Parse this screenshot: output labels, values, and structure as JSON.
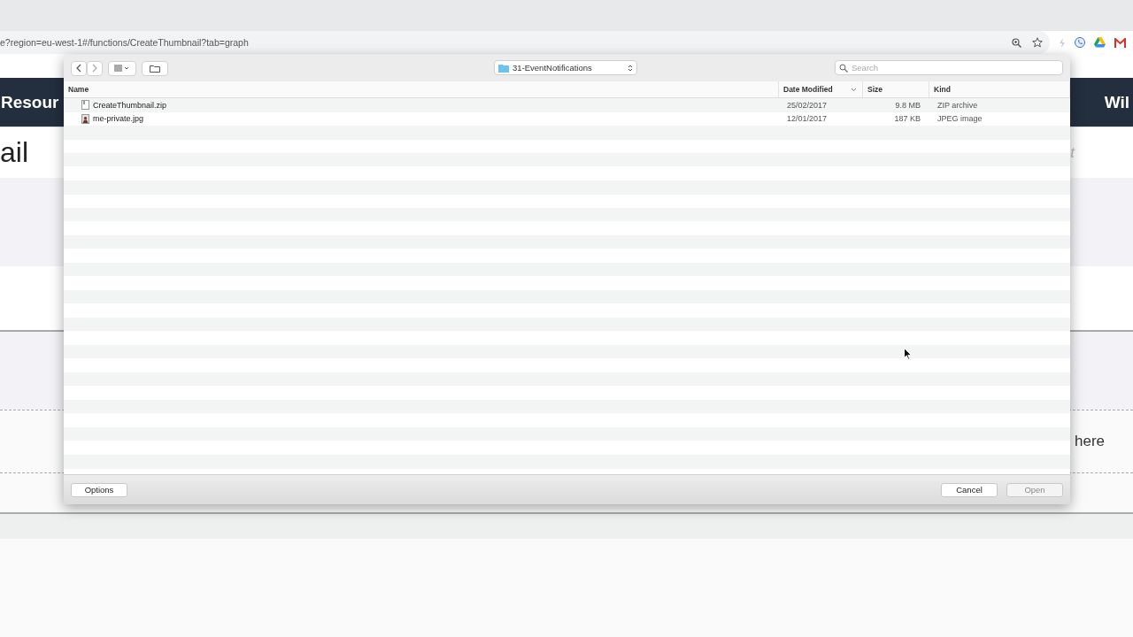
{
  "browser": {
    "url": "e?region=eu-west-1#/functions/CreateThumbnail?tab=graph"
  },
  "page": {
    "nav_left": "Resour",
    "nav_right": "Wil",
    "heading": "ail",
    "search_hint": "t",
    "drop_hint": "here"
  },
  "dialog": {
    "location": "31-EventNotifications",
    "search": {
      "placeholder": "Search"
    },
    "columns": [
      {
        "label": "Name",
        "sorted": false
      },
      {
        "label": "Date Modified",
        "sorted": true
      },
      {
        "label": "Size",
        "sorted": false
      },
      {
        "label": "Kind",
        "sorted": false
      }
    ],
    "files": [
      {
        "name": "CreateThumbnail.zip",
        "date": "25/02/2017",
        "size": "9.8 MB",
        "description": "ZIP archive",
        "kind": "archive"
      },
      {
        "name": "me-private.jpg",
        "date": "12/01/2017",
        "size": "187 KB",
        "description": "JPEG image",
        "kind": "image"
      }
    ],
    "options_button": {
      "label": "Options"
    },
    "buttons": [
      {
        "label": "Cancel",
        "disabled": false
      },
      {
        "label": "Open",
        "disabled": true
      }
    ]
  }
}
